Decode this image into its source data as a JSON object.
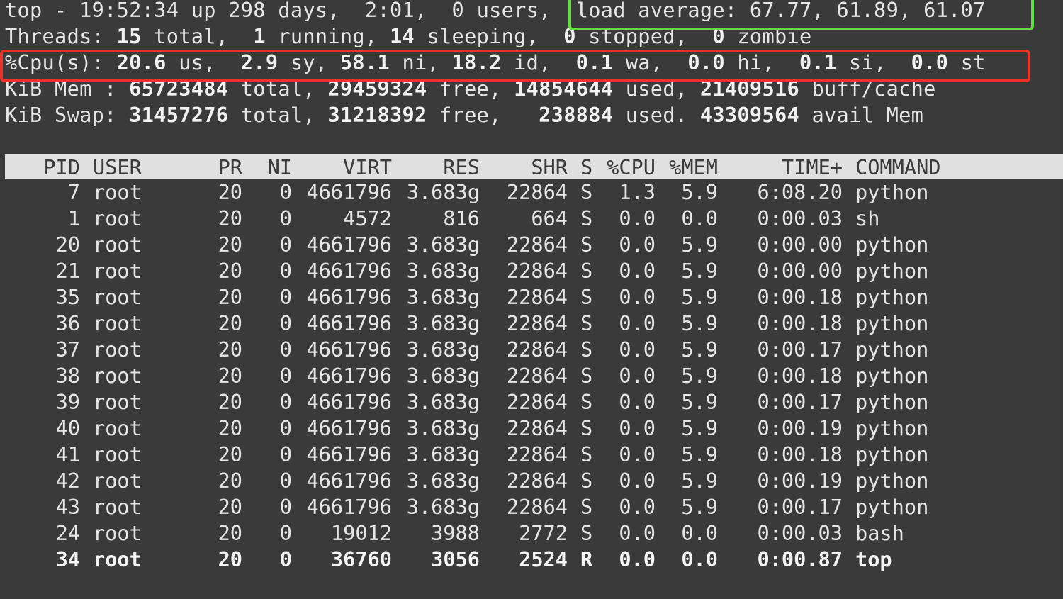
{
  "summary": {
    "line1": {
      "prefix": "top - 19:52:34 up 298 days,  2:01,  0 users,  ",
      "load_label": "load average: ",
      "load_values": "67.77, 61.89, 61.07"
    },
    "threads": {
      "label": "Threads: ",
      "total": "15",
      "total_label": " total,  ",
      "running": "1",
      "running_label": " running, ",
      "sleeping": "14",
      "sleeping_label": " sleeping,  ",
      "stopped": "0",
      "stopped_label": " stopped,  ",
      "zombie": "0",
      "zombie_label": " zombie"
    },
    "cpu": {
      "label": "%Cpu(s): ",
      "us": "20.6",
      "us_label": " us,  ",
      "sy": "2.9",
      "sy_label": " sy, ",
      "ni": "58.1",
      "ni_label": " ni, ",
      "id": "18.2",
      "id_label": " id,  ",
      "wa": "0.1",
      "wa_label": " wa,  ",
      "hi": "0.0",
      "hi_label": " hi,  ",
      "si": "0.1",
      "si_label": " si,  ",
      "st": "0.0",
      "st_label": " st"
    },
    "mem": {
      "label": "KiB Mem : ",
      "total": "65723484",
      "total_label": " total, ",
      "free": "29459324",
      "free_label": " free, ",
      "used": "14854644",
      "used_label": " used, ",
      "buff": "21409516",
      "buff_label": " buff/cache"
    },
    "swap": {
      "label": "KiB Swap: ",
      "total": "31457276",
      "total_label": " total, ",
      "free": "31218392",
      "free_label": " free,   ",
      "used": "238884",
      "used_label": " used. ",
      "avail": "43309564",
      "avail_label": " avail Mem"
    }
  },
  "highlights": {
    "load_average_box_color": "#5ee03a",
    "cpu_box_color": "#f0302a"
  },
  "table": {
    "columns": [
      "PID",
      "USER",
      "PR",
      "NI",
      "VIRT",
      "RES",
      "SHR",
      "S",
      "%CPU",
      "%MEM",
      "TIME+",
      "COMMAND"
    ],
    "rows": [
      [
        "7",
        "root",
        "20",
        "0",
        "4661796",
        "3.683g",
        "22864",
        "S",
        "1.3",
        "5.9",
        "6:08.20",
        "python"
      ],
      [
        "1",
        "root",
        "20",
        "0",
        "4572",
        "816",
        "664",
        "S",
        "0.0",
        "0.0",
        "0:00.03",
        "sh"
      ],
      [
        "20",
        "root",
        "20",
        "0",
        "4661796",
        "3.683g",
        "22864",
        "S",
        "0.0",
        "5.9",
        "0:00.00",
        "python"
      ],
      [
        "21",
        "root",
        "20",
        "0",
        "4661796",
        "3.683g",
        "22864",
        "S",
        "0.0",
        "5.9",
        "0:00.00",
        "python"
      ],
      [
        "35",
        "root",
        "20",
        "0",
        "4661796",
        "3.683g",
        "22864",
        "S",
        "0.0",
        "5.9",
        "0:00.18",
        "python"
      ],
      [
        "36",
        "root",
        "20",
        "0",
        "4661796",
        "3.683g",
        "22864",
        "S",
        "0.0",
        "5.9",
        "0:00.18",
        "python"
      ],
      [
        "37",
        "root",
        "20",
        "0",
        "4661796",
        "3.683g",
        "22864",
        "S",
        "0.0",
        "5.9",
        "0:00.17",
        "python"
      ],
      [
        "38",
        "root",
        "20",
        "0",
        "4661796",
        "3.683g",
        "22864",
        "S",
        "0.0",
        "5.9",
        "0:00.18",
        "python"
      ],
      [
        "39",
        "root",
        "20",
        "0",
        "4661796",
        "3.683g",
        "22864",
        "S",
        "0.0",
        "5.9",
        "0:00.17",
        "python"
      ],
      [
        "40",
        "root",
        "20",
        "0",
        "4661796",
        "3.683g",
        "22864",
        "S",
        "0.0",
        "5.9",
        "0:00.19",
        "python"
      ],
      [
        "41",
        "root",
        "20",
        "0",
        "4661796",
        "3.683g",
        "22864",
        "S",
        "0.0",
        "5.9",
        "0:00.18",
        "python"
      ],
      [
        "42",
        "root",
        "20",
        "0",
        "4661796",
        "3.683g",
        "22864",
        "S",
        "0.0",
        "5.9",
        "0:00.19",
        "python"
      ],
      [
        "43",
        "root",
        "20",
        "0",
        "4661796",
        "3.683g",
        "22864",
        "S",
        "0.0",
        "5.9",
        "0:00.17",
        "python"
      ],
      [
        "24",
        "root",
        "20",
        "0",
        "19012",
        "3988",
        "2772",
        "S",
        "0.0",
        "0.0",
        "0:00.03",
        "bash"
      ],
      [
        "34",
        "root",
        "20",
        "0",
        "36760",
        "3056",
        "2524",
        "R",
        "0.0",
        "0.0",
        "0:00.87",
        "top"
      ]
    ],
    "bold_row_index": 14
  }
}
